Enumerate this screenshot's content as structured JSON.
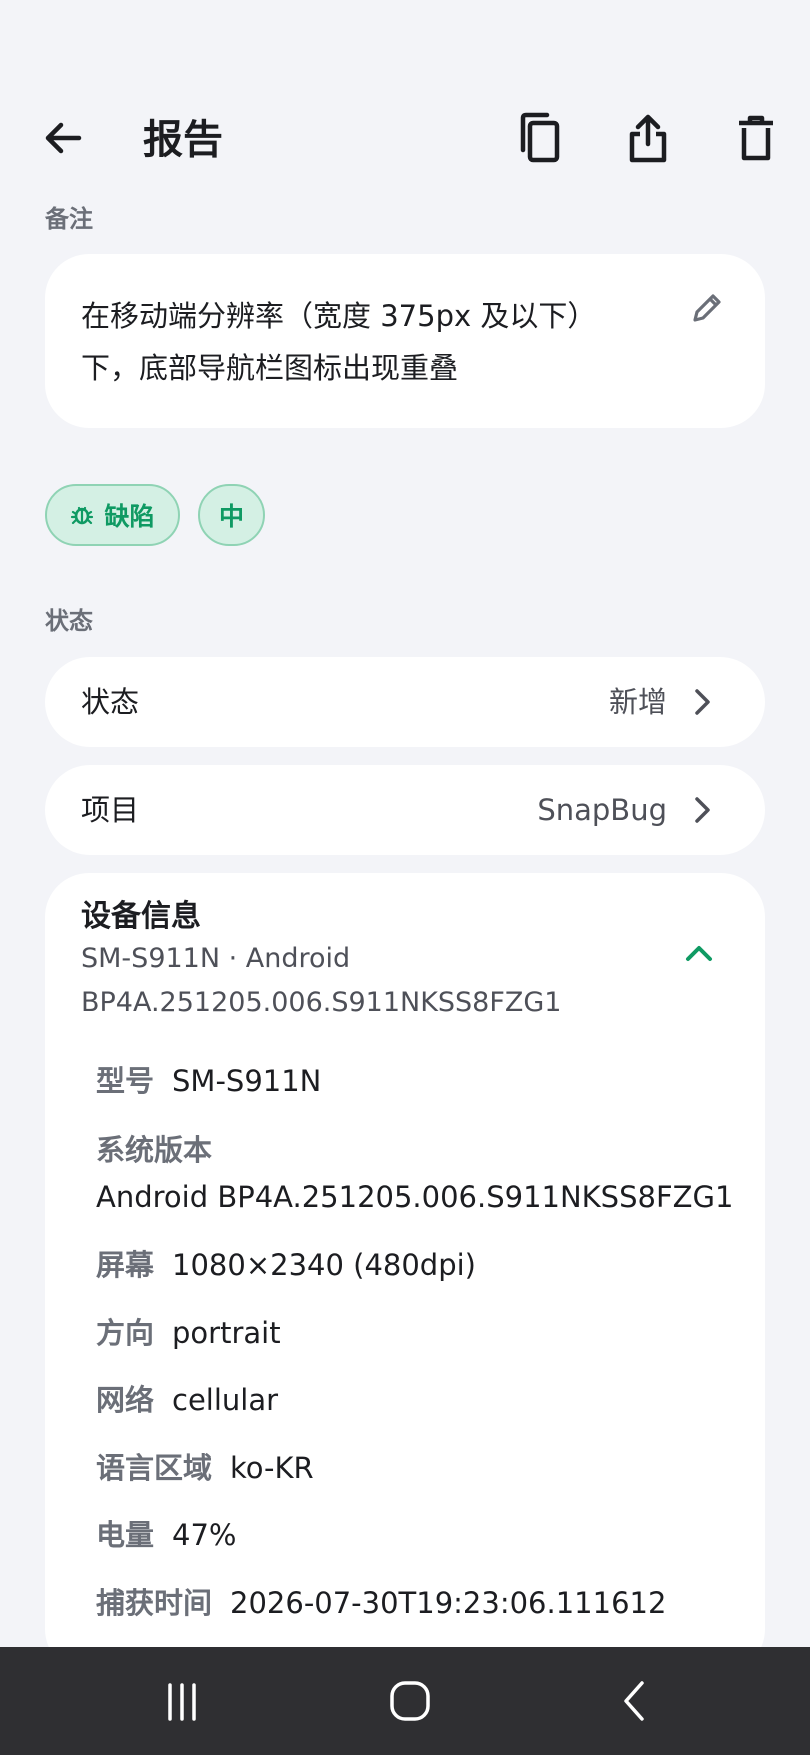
{
  "app_bar": {
    "title": "报告",
    "back_icon": "arrow-left-icon",
    "actions": [
      "copy-icon",
      "share-icon",
      "delete-icon"
    ]
  },
  "note_section": {
    "label": "备注",
    "text": "在移动端分辨率（宽度 375px 及以下）下，底部导航栏图标出现重叠",
    "edit_icon": "pencil-icon"
  },
  "tags": {
    "type_label": "缺陷",
    "type_icon": "bug-icon",
    "severity_label": "中"
  },
  "status_section": {
    "label": "状态",
    "rows": [
      {
        "label": "状态",
        "value": "新增"
      },
      {
        "label": "项目",
        "value": "SnapBug"
      }
    ]
  },
  "device_info": {
    "title": "设备信息",
    "summary_line1": "SM-S911N · Android",
    "summary_line2": "BP4A.251205.006.S911NKSS8FZG1",
    "collapse_icon": "chevron-up-icon",
    "fields": [
      {
        "key": "型号",
        "value": "SM-S911N"
      },
      {
        "key": "系统版本",
        "value": "Android BP4A.251205.006.S911NKSS8FZG1"
      },
      {
        "key": "屏幕",
        "value": "1080×2340 (480dpi)"
      },
      {
        "key": "方向",
        "value": "portrait"
      },
      {
        "key": "网络",
        "value": "cellular"
      },
      {
        "key": "语言区域",
        "value": "ko-KR"
      },
      {
        "key": "电量",
        "value": "47%"
      },
      {
        "key": "捕获时间",
        "value": "2026-07-30T19:23:06.111612"
      }
    ]
  },
  "colors": {
    "background": "#f3f4f8",
    "card": "#ffffff",
    "accent": "#0f9a63",
    "chip_bg": "#d4f0e4",
    "navbar": "#2f2f32"
  },
  "system_nav": [
    "recents-icon",
    "home-icon",
    "back-icon"
  ]
}
